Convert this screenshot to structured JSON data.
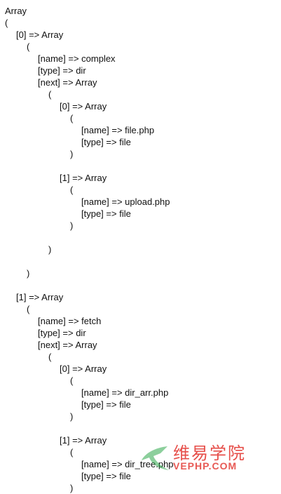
{
  "lines": [
    "Array",
    "(",
    "[0] => Array",
    "(",
    "[name] => complex",
    "[type] => dir",
    "[next] => Array",
    "(",
    "[0] => Array",
    "(",
    "[name] => file.php",
    "[type] => file",
    ")",
    "",
    "[1] => Array",
    "(",
    "[name] => upload.php",
    "[type] => file",
    ")",
    "",
    ")",
    "",
    ")",
    "",
    "[1] => Array",
    "(",
    "[name] => fetch",
    "[type] => dir",
    "[next] => Array",
    "(",
    "[0] => Array",
    "(",
    "[name] => dir_arr.php",
    "[type] => file",
    ")",
    "",
    "[1] => Array",
    "(",
    "[name] => dir_tree.php",
    "[type] => file",
    ")"
  ],
  "watermark": {
    "cn_text": "维易学院",
    "en_text": "VEPHP.COM",
    "color": "#e2302a",
    "icon": "arrow-logo-icon"
  }
}
